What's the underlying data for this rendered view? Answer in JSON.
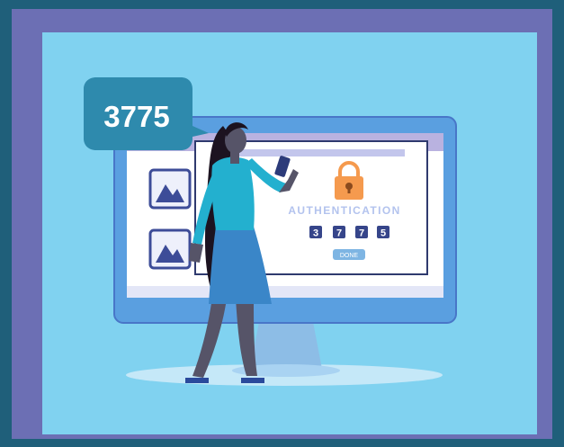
{
  "speech_bubble": {
    "code": "3775"
  },
  "auth_panel": {
    "title": "AUTHENTICATION",
    "digits": [
      "3",
      "7",
      "7",
      "5"
    ],
    "done_label": "DONE",
    "lock_icon": "padlock-icon"
  },
  "sidebar_icons": [
    "image-icon",
    "image-icon"
  ],
  "colors": {
    "outer_background": "#1f5f7a",
    "frame": "#6c6fb4",
    "canvas": "#80d2f0",
    "monitor": "#5a9fe0",
    "screen_white": "#ffffff",
    "lock": "#f59a4e",
    "digit_box": "#36458a",
    "done_button": "#7eb5e3",
    "bubble": "#2e8aad",
    "dress": "#3a86c8",
    "top": "#23b0cf"
  }
}
